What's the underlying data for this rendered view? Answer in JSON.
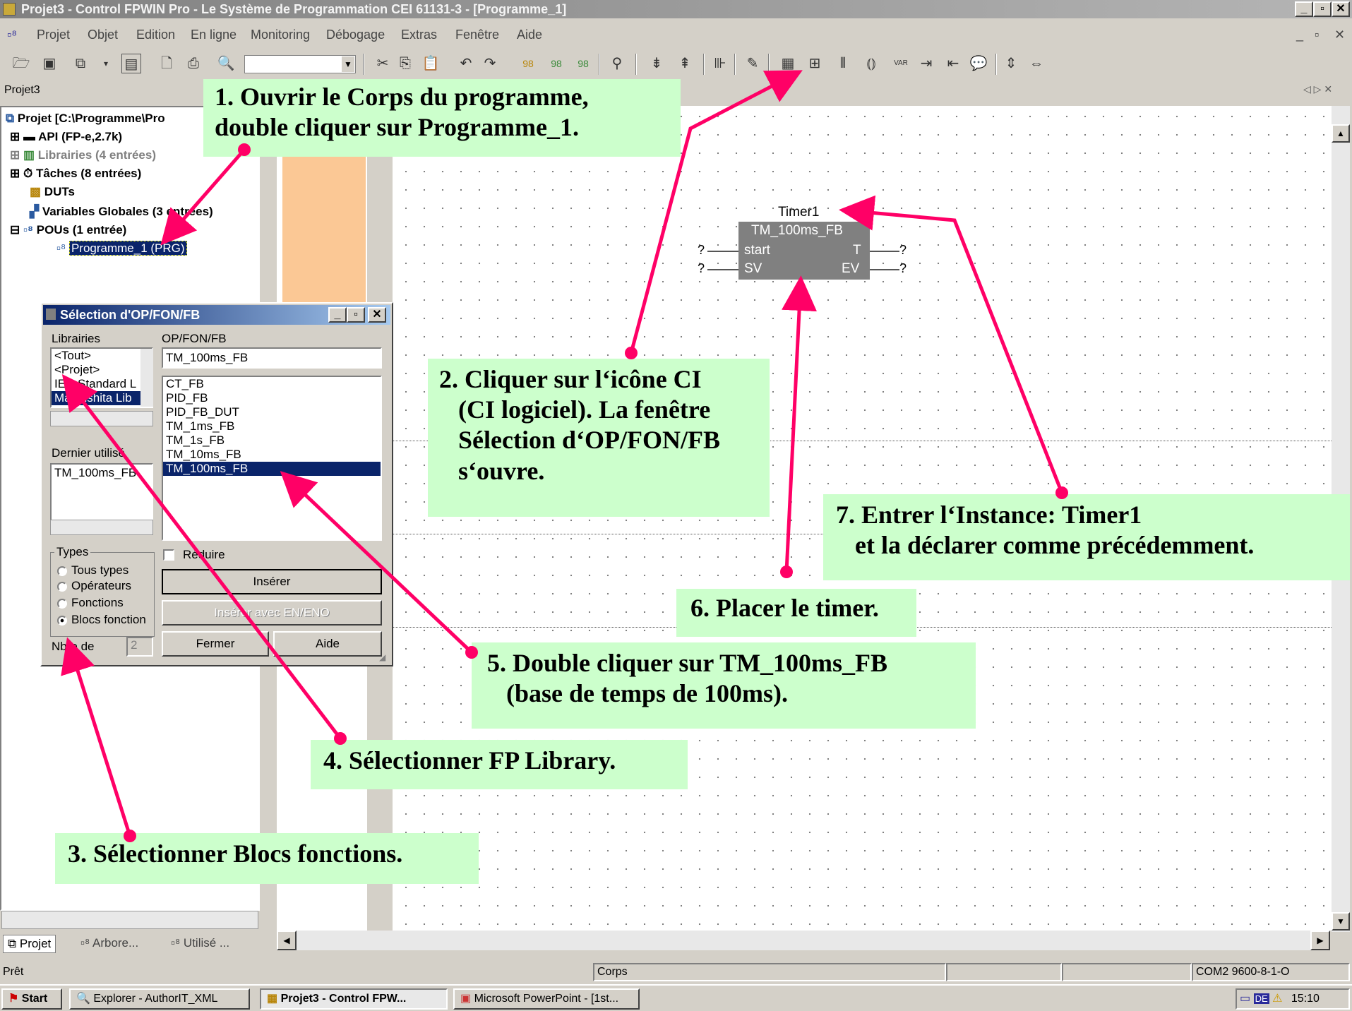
{
  "app": {
    "title": "Projet3 - Control FPWIN Pro - Le Système de Programmation CEI 61131-3 - [Programme_1]"
  },
  "menu": [
    "Projet",
    "Objet",
    "Edition",
    "En ligne",
    "Monitoring",
    "Débogage",
    "Extras",
    "Fenêtre",
    "Aide"
  ],
  "panel": {
    "title": "Projet3",
    "tabs": [
      "Projet",
      "Arbore...",
      "Utilisé ..."
    ]
  },
  "tree": {
    "root": "Projet [C:\\Programme\\Pro",
    "items": [
      {
        "label": "API (FP-e,2.7k)"
      },
      {
        "label": "Librairies (4 entrées)"
      },
      {
        "label": "Tâches (8 entrées)"
      },
      {
        "label": "DUTs"
      },
      {
        "label": "Variables Globales (3 entrées)"
      },
      {
        "label": "POUs (1 entrée)"
      },
      {
        "label": "Programme_1 (PRG)"
      }
    ]
  },
  "fb": {
    "instance": "Timer1",
    "type": "TM_100ms_FB",
    "in1": "start",
    "in2": "SV",
    "out1": "T",
    "out2": "EV",
    "q": "?"
  },
  "dialog": {
    "title": "Sélection d'OP/FON/FB",
    "lib_label": "Librairies",
    "op_label": "OP/FON/FB",
    "lib_items": [
      "<Tout>",
      "<Projet>",
      "IEC Standard L",
      "Matsushita Lib"
    ],
    "op_input": "TM_100ms_FB",
    "op_items": [
      "CT_FB",
      "PID_FB",
      "PID_FB_DUT",
      "TM_1ms_FB",
      "TM_1s_FB",
      "TM_10ms_FB",
      "TM_100ms_FB"
    ],
    "last_label": "Dernier utilisé",
    "last_items": [
      "TM_100ms_FB"
    ],
    "types_label": "Types",
    "types": [
      "Tous types",
      "Opérateurs",
      "Fonctions",
      "Blocs fonction"
    ],
    "reduce": "Réduire",
    "insert": "Insérer",
    "insert_en": "Insérer avec EN/ENO",
    "close": "Fermer",
    "help": "Aide",
    "count_label": "Nbre de",
    "count_value": "2"
  },
  "notes": {
    "n1": "1. Ouvrir le Corps du programme,\ndouble cliquer sur Programme_1.",
    "n2": "2. Cliquer sur l‘icône CI\n   (CI logiciel). La fenêtre\n   Sélection d‘OP/FON/FB\n   s‘ouvre.",
    "n3": "3. Sélectionner Blocs fonctions.",
    "n4": "4. Sélectionner FP Library.",
    "n5": "5. Double cliquer sur TM_100ms_FB\n   (base de temps de 100ms).",
    "n6": "6. Placer le timer.",
    "n7": "7. Entrer l‘Instance: Timer1\n   et la déclarer comme précédemment."
  },
  "status": {
    "left": "Prêt",
    "mid": "Corps",
    "right": "COM2 9600-8-1-O"
  },
  "taskbar": {
    "start": "Start",
    "tasks": [
      "Explorer - AuthorIT_XML",
      "Projet3 - Control FPW...",
      "Microsoft PowerPoint - [1st..."
    ],
    "lang": "DE",
    "clock": "15:10"
  },
  "colors": {
    "note_bg": "#ccffcc",
    "arrow": "#ff0066",
    "dialog_title": "#0a246a",
    "editor_strip": "#fbc895"
  }
}
